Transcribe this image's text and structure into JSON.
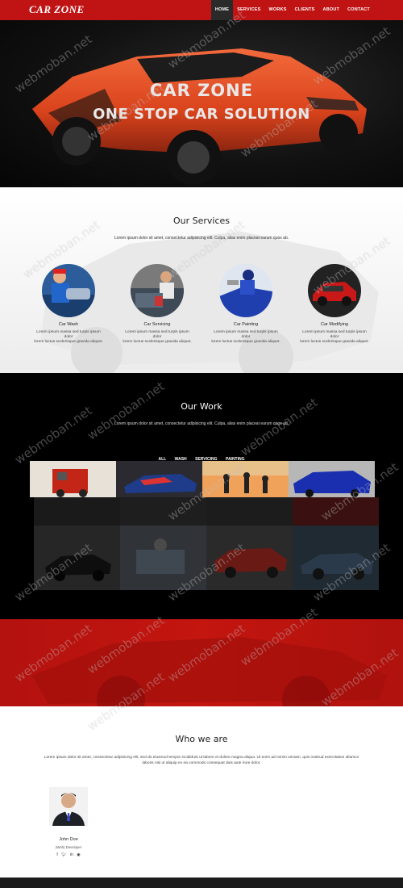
{
  "nav": {
    "logo": "CAR ZONE",
    "items": [
      {
        "label": "HOME",
        "active": true
      },
      {
        "label": "SERVICES"
      },
      {
        "label": "WORKS"
      },
      {
        "label": "CLIENTS"
      },
      {
        "label": "ABOUT"
      },
      {
        "label": "CONTACT"
      }
    ]
  },
  "hero": {
    "title": "CAR ZONE",
    "subtitle": "ONE STOP CAR SOLUTION"
  },
  "services": {
    "title": "Our Services",
    "subtitle": "Lorem ipsum dolor sit amet, consectetur adipisicing elit. Culpa, alias enim placeat earum quos ab.",
    "items": [
      {
        "name": "Car Wash",
        "desc1": "Lorem ipsum massa sed turpis ipsum dolor",
        "desc2": "lorem luctus scelerisque gravida aliquet."
      },
      {
        "name": "Car Servicing",
        "desc1": "Lorem ipsum massa sed turpis ipsum dolor",
        "desc2": "lorem luctus scelerisque gravida aliquet."
      },
      {
        "name": "Car Painting",
        "desc1": "Lorem ipsum massa sed turpis ipsum dolor",
        "desc2": "lorem luctus scelerisque gravida aliquet."
      },
      {
        "name": "Car Modifying",
        "desc1": "Lorem ipsum massa sed turpis ipsum dolor",
        "desc2": "lorem luctus scelerisque gravida aliquet."
      }
    ]
  },
  "work": {
    "title": "Our Work",
    "subtitle": "Lorem ipsum dolor sit amet, consectetur adipisicing elit. Culpa, alias enim placeat earum quos ab.",
    "filters": [
      "ALL",
      "WASH",
      "SERVICING",
      "PAINTING"
    ]
  },
  "who": {
    "title": "Who we are",
    "text1": "Lorem ipsum dolor sit amet, consectetur adipisicing elit, sed do eiusmod tempor incididunt ut labore et dolore magna aliqua. Ut enim ad minim veniam, quis nostrud exercitation ullamco",
    "text2": "laboris nisi ut aliquip ex ea commodo consequat duis aute irure dolor.",
    "member": {
      "name": "John Doe",
      "role": "(Web) Developer"
    },
    "social_icons": [
      "facebook-icon",
      "twitter-icon",
      "linkedin-icon",
      "github-icon"
    ]
  },
  "watermark": "webmoban.net",
  "colors": {
    "brand_red": "#c01414",
    "dark": "#000000",
    "nav_active": "#2a2a2a"
  }
}
